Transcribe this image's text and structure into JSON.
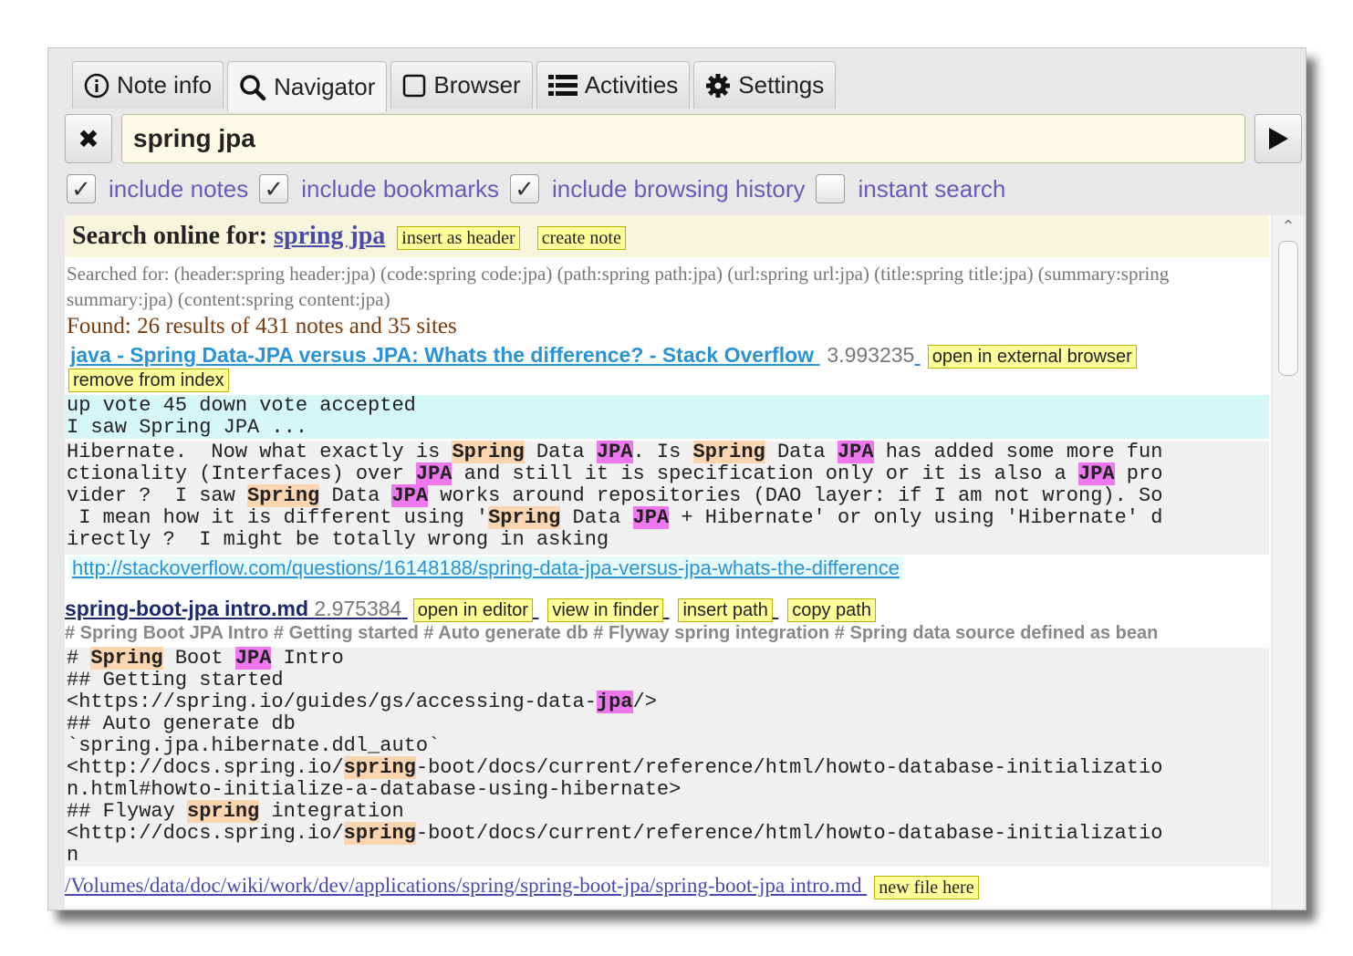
{
  "tabs": [
    {
      "label": "Note info",
      "icon": "info-icon"
    },
    {
      "label": "Navigator",
      "icon": "search-icon",
      "active": true
    },
    {
      "label": "Browser",
      "icon": "square-icon"
    },
    {
      "label": "Activities",
      "icon": "list-icon"
    },
    {
      "label": "Settings",
      "icon": "gear-icon"
    }
  ],
  "search": {
    "value": "spring jpa",
    "clear_label": "✖"
  },
  "options": [
    {
      "label": "include notes",
      "checked": true
    },
    {
      "label": "include bookmarks",
      "checked": true
    },
    {
      "label": "include browsing history",
      "checked": true
    },
    {
      "label": "instant search",
      "checked": false
    }
  ],
  "online": {
    "label": "Search online for:",
    "query": "spring jpa",
    "insert_header": "insert as header",
    "create_note": "create note"
  },
  "searched_for": "Searched for: (header:spring header:jpa) (code:spring code:jpa) (path:spring path:jpa) (url:spring url:jpa) (title:spring title:jpa) (summary:spring summary:jpa) (content:spring content:jpa)",
  "found": "Found: 26 results of 431 notes and 35 sites",
  "result1": {
    "title": "java - Spring Data-JPA versus JPA: Whats the difference? - Stack Overflow",
    "score": "3.993235",
    "open_external": "open in external browser",
    "remove_index": "remove from index",
    "snippet1": "up vote 45 down vote accepted\nI saw Spring JPA ...",
    "url": "http://stackoverflow.com/questions/16148188/spring-data-jpa-versus-jpa-whats-the-difference"
  },
  "result2": {
    "title": "spring-boot-jpa intro.md",
    "score": "2.975384",
    "buttons": [
      "open in editor",
      "view in finder",
      "insert path",
      "copy path"
    ],
    "headers": "# Spring Boot JPA Intro # Getting started # Auto generate db # Flyway spring integration # Spring data source defined as bean",
    "path": "/Volumes/data/doc/wiki/work/dev/applications/spring/spring-boot-jpa/spring-boot-jpa intro.md",
    "new_file": "new file here"
  },
  "colors": {
    "accent_link": "#2a93d5",
    "yellow_button": "#ffff99",
    "highlight_spring": "#fbd5b0",
    "highlight_jpa": "#ee77ee"
  }
}
